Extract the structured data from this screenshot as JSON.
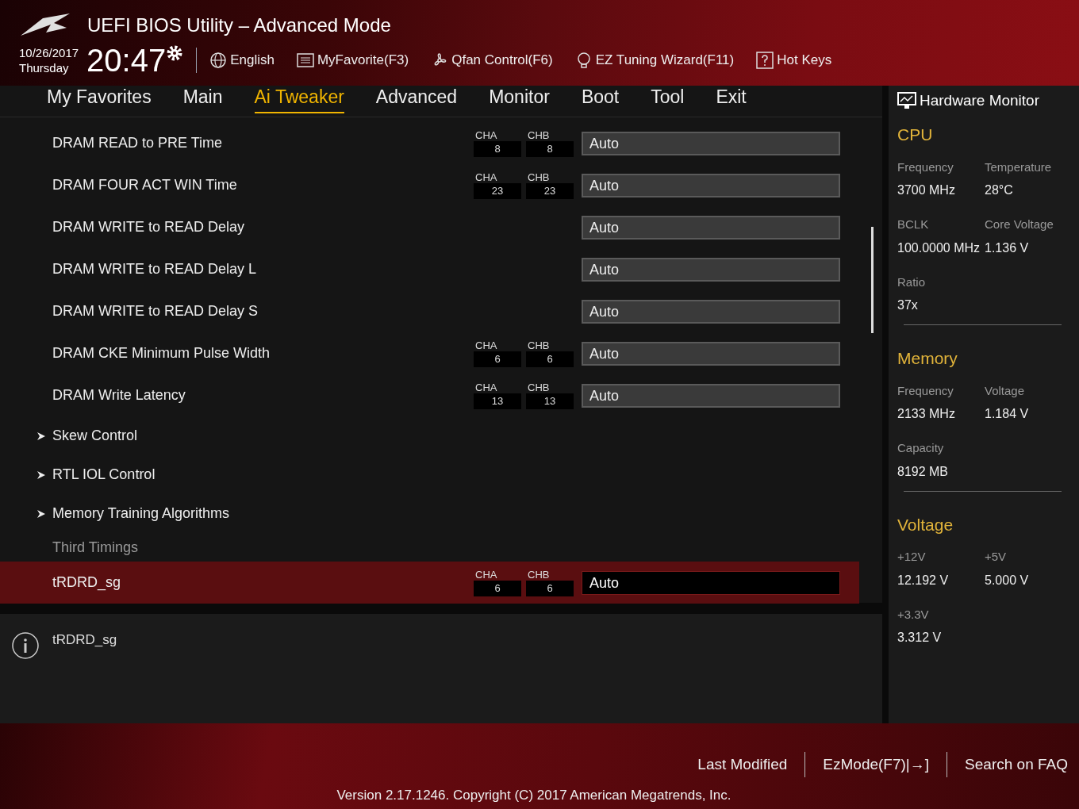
{
  "header": {
    "title": "UEFI BIOS Utility – Advanced Mode",
    "date": "10/26/2017",
    "weekday": "Thursday",
    "time": "20:47",
    "tools": [
      {
        "kind": "globe",
        "label": "English"
      },
      {
        "kind": "list",
        "label": "MyFavorite(F3)"
      },
      {
        "kind": "fan",
        "label": "Qfan Control(F6)"
      },
      {
        "kind": "bulb",
        "label": "EZ Tuning Wizard(F11)"
      },
      {
        "kind": "help",
        "label": "Hot Keys"
      }
    ]
  },
  "tabs": [
    {
      "label": "My Favorites",
      "selected": false
    },
    {
      "label": "Main",
      "selected": false
    },
    {
      "label": "Ai Tweaker",
      "selected": true
    },
    {
      "label": "Advanced",
      "selected": false
    },
    {
      "label": "Monitor",
      "selected": false
    },
    {
      "label": "Boot",
      "selected": false
    },
    {
      "label": "Tool",
      "selected": false
    },
    {
      "label": "Exit",
      "selected": false
    }
  ],
  "settings": [
    {
      "kind": "setting",
      "label": "DRAM READ to PRE Time",
      "channels": [
        {
          "label": "CHA",
          "value": "8"
        },
        {
          "label": "CHB",
          "value": "8"
        }
      ],
      "value": "Auto",
      "selected": false
    },
    {
      "kind": "setting",
      "label": "DRAM FOUR ACT WIN Time",
      "channels": [
        {
          "label": "CHA",
          "value": "23"
        },
        {
          "label": "CHB",
          "value": "23"
        }
      ],
      "value": "Auto",
      "selected": false
    },
    {
      "kind": "setting",
      "label": "DRAM WRITE to READ Delay",
      "value": "Auto",
      "selected": false
    },
    {
      "kind": "setting",
      "label": "DRAM WRITE to READ Delay L",
      "value": "Auto",
      "selected": false
    },
    {
      "kind": "setting",
      "label": "DRAM WRITE to READ Delay S",
      "value": "Auto",
      "selected": false
    },
    {
      "kind": "setting",
      "label": "DRAM CKE Minimum Pulse Width",
      "channels": [
        {
          "label": "CHA",
          "value": "6"
        },
        {
          "label": "CHB",
          "value": "6"
        }
      ],
      "value": "Auto",
      "selected": false
    },
    {
      "kind": "setting",
      "label": "DRAM Write Latency",
      "channels": [
        {
          "label": "CHA",
          "value": "13"
        },
        {
          "label": "CHB",
          "value": "13"
        }
      ],
      "value": "Auto",
      "selected": false
    },
    {
      "kind": "submenu",
      "label": "Skew Control"
    },
    {
      "kind": "submenu",
      "label": "RTL IOL Control"
    },
    {
      "kind": "submenu",
      "label": "Memory Training Algorithms"
    },
    {
      "kind": "section",
      "label": "Third Timings"
    },
    {
      "kind": "setting",
      "label": "tRDRD_sg",
      "channels": [
        {
          "label": "CHA",
          "value": "6"
        },
        {
          "label": "CHB",
          "value": "6"
        }
      ],
      "value": "Auto",
      "selected": true
    }
  ],
  "help": {
    "text": "tRDRD_sg"
  },
  "hardware_monitor": {
    "title": "Hardware Monitor",
    "groups": [
      {
        "title": "CPU",
        "items": [
          {
            "label": "Frequency",
            "value": "3700 MHz"
          },
          {
            "label": "Temperature",
            "value": "28°C"
          },
          {
            "label": "BCLK",
            "value": "100.0000 MHz"
          },
          {
            "label": "Core Voltage",
            "value": "1.136 V"
          },
          {
            "label": "Ratio",
            "value": "37x"
          }
        ]
      },
      {
        "title": "Memory",
        "items": [
          {
            "label": "Frequency",
            "value": "2133 MHz"
          },
          {
            "label": "Voltage",
            "value": "1.184 V"
          },
          {
            "label": "Capacity",
            "value": "8192 MB"
          }
        ]
      },
      {
        "title": "Voltage",
        "items": [
          {
            "label": "+12V",
            "value": "12.192 V"
          },
          {
            "label": "+5V",
            "value": "5.000 V"
          },
          {
            "label": "+3.3V",
            "value": "3.312 V"
          }
        ]
      }
    ]
  },
  "footer": {
    "links": [
      "Last Modified",
      "EzMode(F7)|→]",
      "Search on FAQ"
    ],
    "version": "Version 2.17.1246. Copyright (C) 2017 American Megatrends, Inc."
  }
}
